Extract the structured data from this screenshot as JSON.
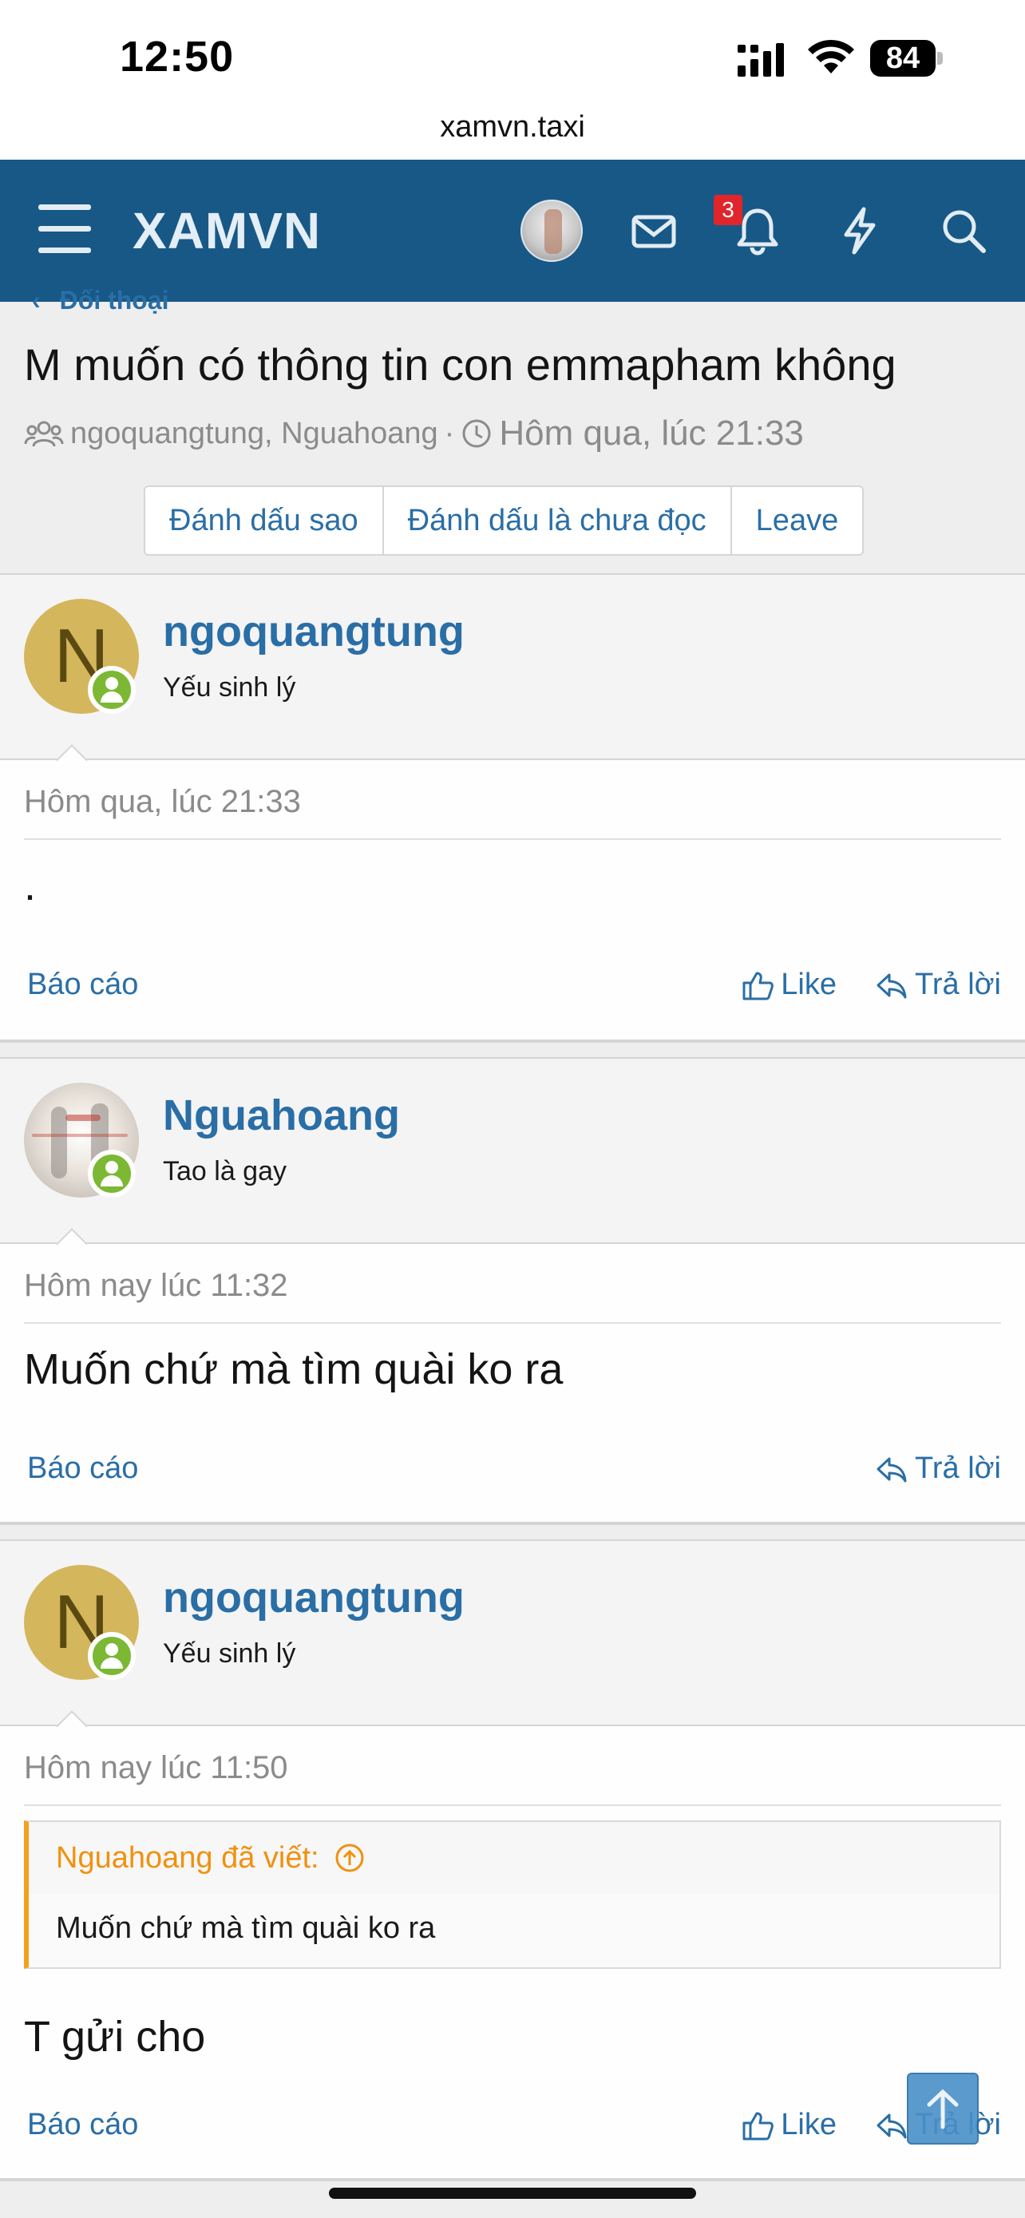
{
  "status_bar": {
    "time": "12:50",
    "battery": "84"
  },
  "browser": {
    "url": "xamvn.taxi"
  },
  "nav": {
    "logo": "XAMVN",
    "alerts_badge": "3",
    "icons": [
      "menu-icon",
      "avatar",
      "mail-icon",
      "bell-icon",
      "lightning-icon",
      "search-icon"
    ]
  },
  "conversation": {
    "breadcrumb": "Đối thoại",
    "title": "M muốn có thông tin con emmapham không",
    "participants": "ngoquangtung, Nguahoang",
    "separator": "·",
    "started": "Hôm qua, lúc 21:33",
    "buttons": {
      "star": "Đánh dấu sao",
      "mark_unread": "Đánh dấu là chưa đọc",
      "leave": "Leave"
    }
  },
  "posts": [
    {
      "username": "ngoquangtung",
      "avatar_letter": "N",
      "user_title": "Yếu sinh lý",
      "date": "Hôm qua, lúc 21:33",
      "body": ".",
      "report": "Báo cáo",
      "like": "Like",
      "reply": "Trả lời"
    },
    {
      "username": "Nguahoang",
      "user_title": "Tao là gay",
      "date": "Hôm nay lúc 11:32",
      "body": "Muốn chứ mà tìm quài ko ra",
      "report": "Báo cáo",
      "reply": "Trả lời"
    },
    {
      "username": "ngoquangtung",
      "avatar_letter": "N",
      "user_title": "Yếu sinh lý",
      "date": "Hôm nay lúc 11:50",
      "quote_author": "Nguahoang đã viết:",
      "quote_text": "Muốn chứ mà tìm quài ko ra",
      "body": "T gửi cho",
      "report": "Báo cáo",
      "like": "Like",
      "reply": "Trả lời"
    }
  ],
  "colors": {
    "nav_bg": "#185886",
    "link": "#2a6ea6",
    "online": "#7cb833",
    "quote_accent": "#f3a11d",
    "badge": "#e0262b"
  }
}
